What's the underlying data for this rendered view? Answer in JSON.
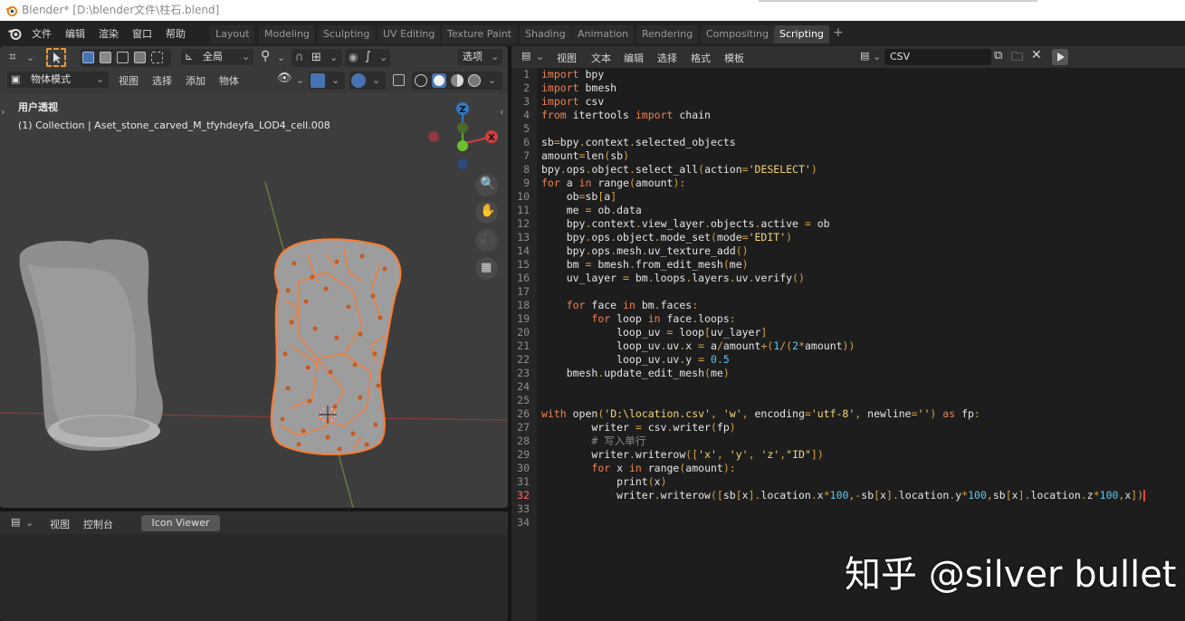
{
  "window": {
    "title": "Blender* [D:\\blender文件\\柱石.blend]"
  },
  "menu": [
    "文件",
    "编辑",
    "渲染",
    "窗口",
    "帮助"
  ],
  "workspaces": [
    {
      "label": "Layout",
      "active": false
    },
    {
      "label": "Modeling",
      "active": false
    },
    {
      "label": "Sculpting",
      "active": false
    },
    {
      "label": "UV Editing",
      "active": false
    },
    {
      "label": "Texture Paint",
      "active": false
    },
    {
      "label": "Shading",
      "active": false
    },
    {
      "label": "Animation",
      "active": false
    },
    {
      "label": "Rendering",
      "active": false
    },
    {
      "label": "Compositing",
      "active": false
    },
    {
      "label": "Scripting",
      "active": true
    }
  ],
  "workspace_add": "+",
  "viewport": {
    "orientation": "全局",
    "options": "选项",
    "mode": "物体模式",
    "menu": [
      "视图",
      "选择",
      "添加",
      "物体"
    ],
    "view_name": "用户透视",
    "collection_info": "(1) Collection | Aset_stone_carved_M_tfyhdeyfa_LOD4_cell.008",
    "gizmo": {
      "z": "Z",
      "x": "X",
      "y": "Y"
    }
  },
  "console": {
    "menu": [
      "视图",
      "控制台"
    ],
    "icon_viewer": "Icon Viewer"
  },
  "text_editor": {
    "menu": [
      "视图",
      "文本",
      "编辑",
      "选择",
      "格式",
      "模板"
    ],
    "file_name": "CSV",
    "current_line": 32
  },
  "code_lines": [
    "import bpy",
    "import bmesh",
    "import csv",
    "from itertools import chain",
    "",
    "sb=bpy.context.selected_objects",
    "amount=len(sb)",
    "bpy.ops.object.select_all(action='DESELECT')",
    "for a in range(amount):",
    "    ob=sb[a]",
    "    me = ob.data",
    "    bpy.context.view_layer.objects.active = ob",
    "    bpy.ops.object.mode_set(mode='EDIT')",
    "    bpy.ops.mesh.uv_texture_add()",
    "    bm = bmesh.from_edit_mesh(me)",
    "    uv_layer = bm.loops.layers.uv.verify()",
    "",
    "    for face in bm.faces:",
    "        for loop in face.loops:",
    "            loop_uv = loop[uv_layer]",
    "            loop_uv.uv.x = a/amount+(1/(2*amount))",
    "            loop_uv.uv.y = 0.5",
    "    bmesh.update_edit_mesh(me)",
    "",
    "",
    "with open('D:\\location.csv', 'w', encoding='utf-8', newline='') as fp:",
    "        writer = csv.writer(fp)",
    "        # 写入单行",
    "        writer.writerow(['x', 'y', 'z',\"ID\"])",
    "        for x in range(amount):",
    "            print(x)",
    "            writer.writerow([sb[x].location.x*100,-sb[x].location.y*100,sb[x].location.z*100,x])",
    "",
    ""
  ],
  "watermark": "知乎 @silver bullet",
  "colors": {
    "accent": "#4772b3",
    "selection": "#ff7a2e",
    "keyword": "#f0824e",
    "string": "#f5d676",
    "number": "#5ec8f0"
  }
}
